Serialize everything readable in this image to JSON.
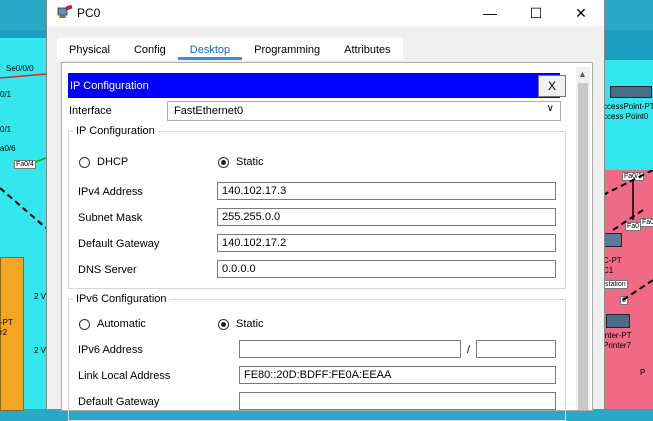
{
  "window": {
    "title": "PC0",
    "controls": {
      "minimize": "—",
      "maximize": "☐",
      "close": "✕"
    }
  },
  "tabs": [
    {
      "label": "Physical",
      "active": false
    },
    {
      "label": "Config",
      "active": false
    },
    {
      "label": "Desktop",
      "active": true
    },
    {
      "label": "Programming",
      "active": false
    },
    {
      "label": "Attributes",
      "active": false
    }
  ],
  "ip_config": {
    "header_title": "IP Configuration",
    "close_label": "X",
    "interface_label": "Interface",
    "interface_value": "FastEthernet0",
    "ipv4_group": {
      "title": "IP Configuration",
      "dhcp_label": "DHCP",
      "static_label": "Static",
      "selected": "Static",
      "ipv4_address_label": "IPv4 Address",
      "ipv4_address_value": "140.102.17.3",
      "subnet_mask_label": "Subnet Mask",
      "subnet_mask_value": "255.255.0.0",
      "default_gateway_label": "Default Gateway",
      "default_gateway_value": "140.102.17.2",
      "dns_server_label": "DNS Server",
      "dns_server_value": "0.0.0.0"
    },
    "ipv6_group": {
      "title": "IPv6 Configuration",
      "automatic_label": "Automatic",
      "static_label": "Static",
      "selected": "Static",
      "ipv6_address_label": "IPv6 Address",
      "ipv6_address_value": "",
      "prefix_separator": "/",
      "prefix_value": "",
      "link_local_label": "Link Local Address",
      "link_local_value": "FE80::20D:BDFF:FE0A:EEAA",
      "default_gateway_label": "Default Gateway",
      "default_gateway_value": ""
    }
  },
  "background": {
    "left_labels": [
      "Se0/0/0",
      "0/1",
      "0/1",
      "a0/6",
      "Fa0/4",
      "-PT",
      "r2",
      "2 V",
      "2 V"
    ],
    "right_labels": [
      "ccessPoint-PT",
      "ccess Point0",
      "Fa0/1",
      "Fa0",
      "Fa0",
      "C-PT",
      "C1",
      "station",
      "0",
      "inter-PT",
      "Printer7",
      "P"
    ]
  },
  "colors": {
    "header_blue": "#0000ff",
    "tab_active": "#1565c0",
    "canvas_cyan": "#34e6ee",
    "canvas_pink": "#f06a86",
    "canvas_orange": "#f4a523"
  }
}
